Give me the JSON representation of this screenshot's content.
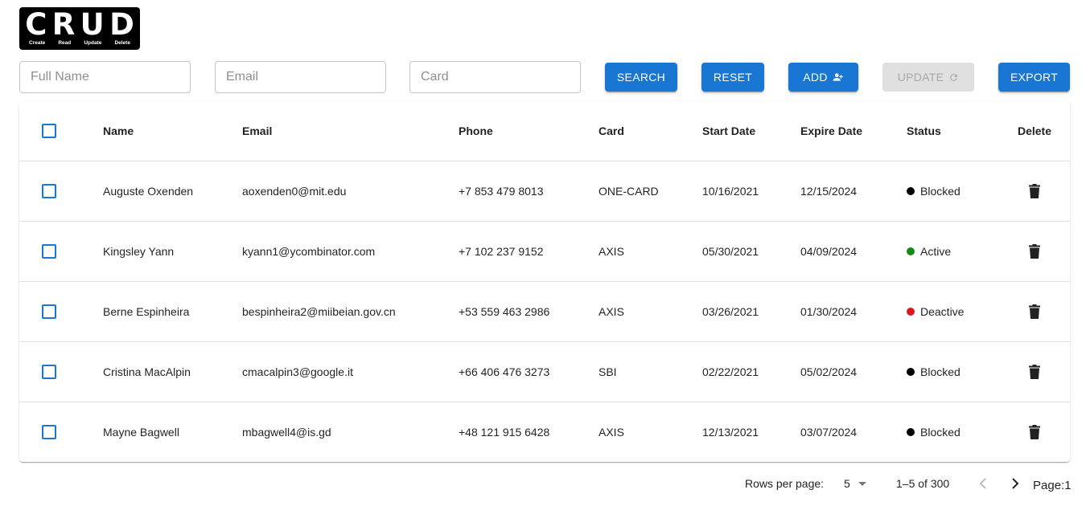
{
  "logo": {
    "letters": [
      "C",
      "R",
      "U",
      "D"
    ],
    "captions": [
      "Create",
      "Read",
      "Update",
      "Delete"
    ]
  },
  "filters": {
    "full_name_placeholder": "Full Name",
    "email_placeholder": "Email",
    "card_placeholder": "Card"
  },
  "toolbar": {
    "search_label": "SEARCH",
    "reset_label": "RESET",
    "add_label": "ADD",
    "update_label": "UPDATE",
    "export_label": "EXPORT"
  },
  "table": {
    "columns": [
      "Name",
      "Email",
      "Phone",
      "Card",
      "Start Date",
      "Expire Date",
      "Status",
      "Delete"
    ],
    "rows": [
      {
        "name": "Auguste Oxenden",
        "email": "aoxenden0@mit.edu",
        "phone": "+7 853 479 8013",
        "card": "ONE-CARD",
        "start": "10/16/2021",
        "expire": "12/15/2024",
        "status": "Blocked",
        "status_color": "#000000"
      },
      {
        "name": "Kingsley Yann",
        "email": "kyann1@ycombinator.com",
        "phone": "+7 102 237 9152",
        "card": "AXIS",
        "start": "05/30/2021",
        "expire": "04/09/2024",
        "status": "Active",
        "status_color": "#138a13"
      },
      {
        "name": "Berne Espinheira",
        "email": "bespinheira2@miibeian.gov.cn",
        "phone": "+53 559 463 2986",
        "card": "AXIS",
        "start": "03/26/2021",
        "expire": "01/30/2024",
        "status": "Deactive",
        "status_color": "#e0181b"
      },
      {
        "name": "Cristina MacAlpin",
        "email": "cmacalpin3@google.it",
        "phone": "+66 406 476 3273",
        "card": "SBI",
        "start": "02/22/2021",
        "expire": "05/02/2024",
        "status": "Blocked",
        "status_color": "#000000"
      },
      {
        "name": "Mayne Bagwell",
        "email": "mbagwell4@is.gd",
        "phone": "+48 121 915 6428",
        "card": "AXIS",
        "start": "12/13/2021",
        "expire": "03/07/2024",
        "status": "Blocked",
        "status_color": "#000000"
      }
    ]
  },
  "pagination": {
    "rows_per_page_label": "Rows per page:",
    "rows_per_page_value": "5",
    "range_text": "1–5 of 300",
    "page_text": "Page:1"
  },
  "colors": {
    "primary": "#1976d2",
    "disabled_bg": "#e0e0e0"
  },
  "icons": {
    "add": "person-add-icon",
    "update": "refresh-icon",
    "delete": "trash-icon",
    "prev": "chevron-left-icon",
    "next": "chevron-right-icon",
    "rows_select": "caret-down-icon"
  }
}
